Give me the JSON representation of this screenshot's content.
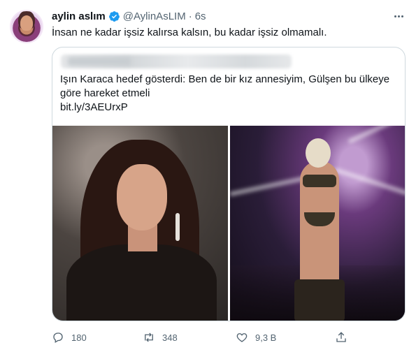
{
  "tweet": {
    "author_name": "aylin aslım",
    "author_handle": "@AylinAsLIM",
    "separator": "·",
    "time": "6s",
    "text": "İnsan ne kadar işsiz kalırsa kalsın, bu kadar işsiz olmamalı.",
    "verified": true
  },
  "quoted": {
    "text": "Işın Karaca hedef gösterdi: Ben de bir kız annesiyim, Gülşen bu ülkeye göre hareket etmeli",
    "link": "bit.ly/3AEUrxP"
  },
  "actions": {
    "reply_count": "180",
    "retweet_count": "348",
    "like_count": "9,3 B"
  },
  "colors": {
    "text": "#0f1419",
    "secondary": "#536471",
    "verified": "#1d9bf0",
    "border": "#cfd9de"
  },
  "icons": [
    "more-icon",
    "verified-badge-icon",
    "reply-icon",
    "retweet-icon",
    "like-icon",
    "share-icon"
  ]
}
